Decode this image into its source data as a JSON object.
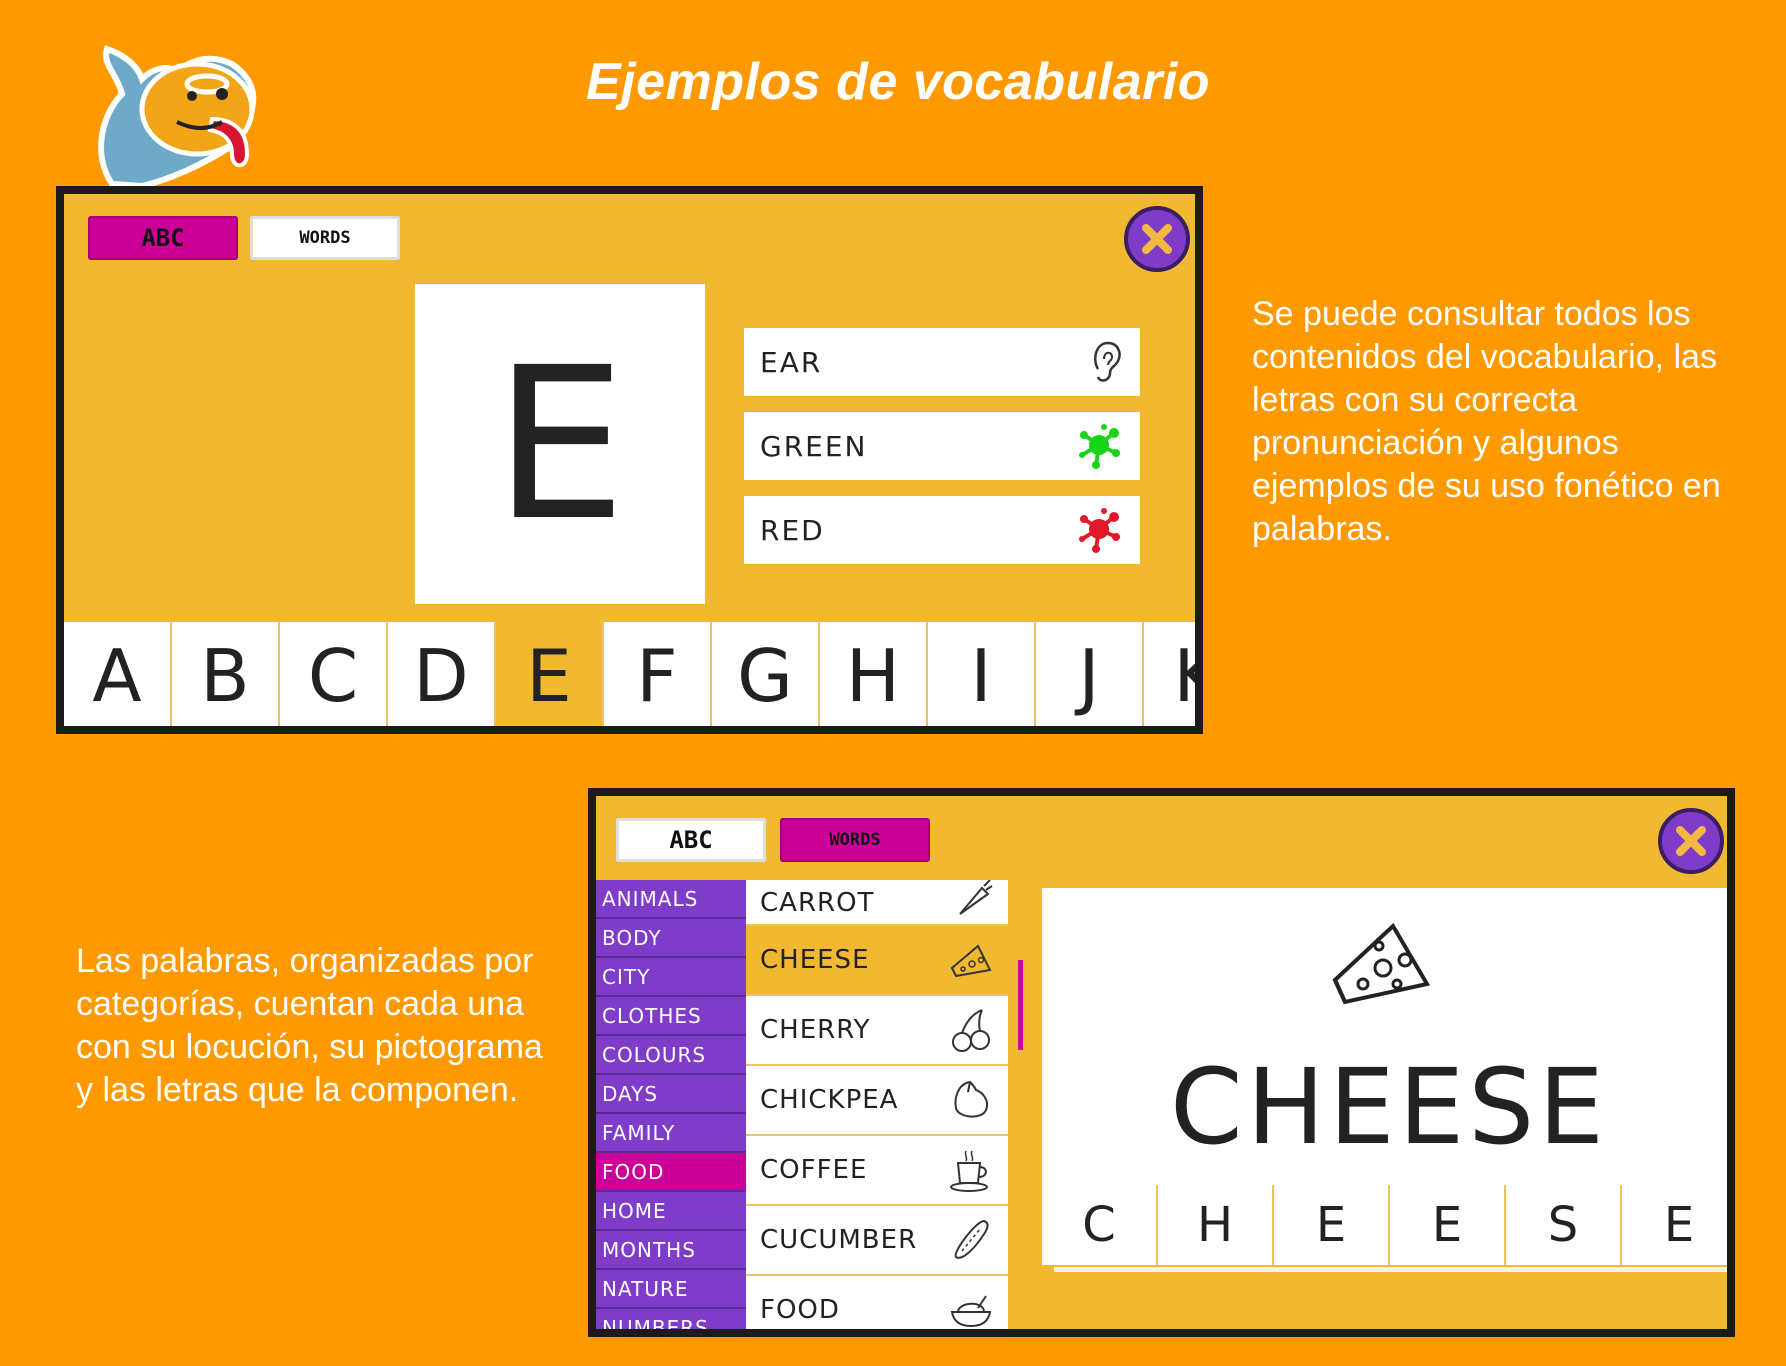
{
  "title": "Ejemplos de vocabulario",
  "descriptions": {
    "top": "Se puede consultar todos los contenidos del vocabulario, las letras con su correcta pronunciación y algunos ejemplos de su uso fonético en palabras.",
    "bottom": "Las palabras, organizadas por categorías, cuentan cada una con su locución, su pictograma y las letras que la componen."
  },
  "colors": {
    "background": "#FF9900",
    "panel": "#F1B932",
    "accent_magenta": "#CC0099",
    "accent_purple": "#7F3CC8"
  },
  "abc_screen": {
    "tabs": [
      {
        "label": "ABC",
        "active": true
      },
      {
        "label": "WORDS",
        "active": false
      }
    ],
    "selected_letter": "E",
    "words": [
      {
        "label": "EAR",
        "icon": "ear-icon"
      },
      {
        "label": "GREEN",
        "icon": "green-splash-icon"
      },
      {
        "label": "RED",
        "icon": "red-splash-icon"
      }
    ],
    "alphabet": [
      "A",
      "B",
      "C",
      "D",
      "E",
      "F",
      "G",
      "H",
      "I",
      "J",
      "K"
    ]
  },
  "words_screen": {
    "tabs": [
      {
        "label": "ABC",
        "active": false
      },
      {
        "label": "WORDS",
        "active": true
      }
    ],
    "categories": [
      "ANIMALS",
      "BODY",
      "CITY",
      "CLOTHES",
      "COLOURS",
      "DAYS",
      "FAMILY",
      "FOOD",
      "HOME",
      "MONTHS",
      "NATURE",
      "NUMBERS"
    ],
    "selected_category": "FOOD",
    "food_items": [
      {
        "label": "CARROT",
        "icon": "carrot-icon"
      },
      {
        "label": "CHEESE",
        "icon": "cheese-icon"
      },
      {
        "label": "CHERRY",
        "icon": "cherry-icon"
      },
      {
        "label": "CHICKPEA",
        "icon": "chickpea-icon"
      },
      {
        "label": "COFFEE",
        "icon": "coffee-icon"
      },
      {
        "label": "CUCUMBER",
        "icon": "cucumber-icon"
      },
      {
        "label": "FOOD",
        "icon": "food-bowl-icon"
      }
    ],
    "selected_word": "CHEESE",
    "spelled_letters": [
      "C",
      "H",
      "E",
      "E",
      "S",
      "E"
    ]
  }
}
